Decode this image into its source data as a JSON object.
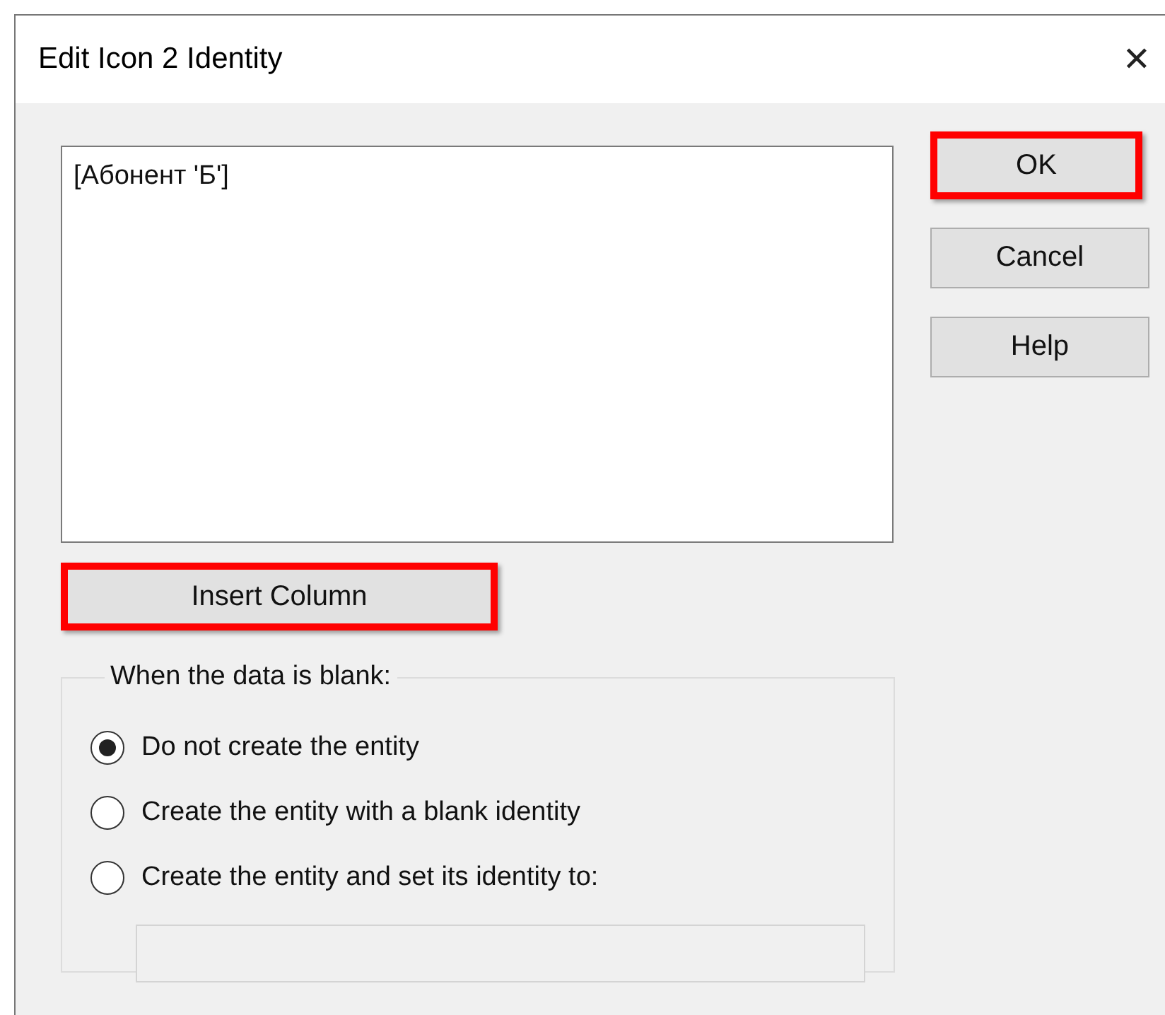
{
  "window": {
    "title": "Edit Icon 2 Identity",
    "close": "✕"
  },
  "identity_text": {
    "value": "[Абонент 'Б']"
  },
  "buttons": [
    {
      "label": "OK",
      "highlighted": true
    },
    {
      "label": "Cancel",
      "highlighted": false
    },
    {
      "label": "Help",
      "highlighted": false
    }
  ],
  "insert_button": {
    "label": "Insert Column",
    "highlighted": true
  },
  "blank_group": {
    "title": "When the data is blank:",
    "options": [
      {
        "label": "Do not create the entity",
        "selected": true
      },
      {
        "label": "Create the entity with a blank identity",
        "selected": false
      },
      {
        "label": "Create the entity and set its identity to:",
        "selected": false
      }
    ],
    "identity_field": {
      "disabled": true
    }
  }
}
